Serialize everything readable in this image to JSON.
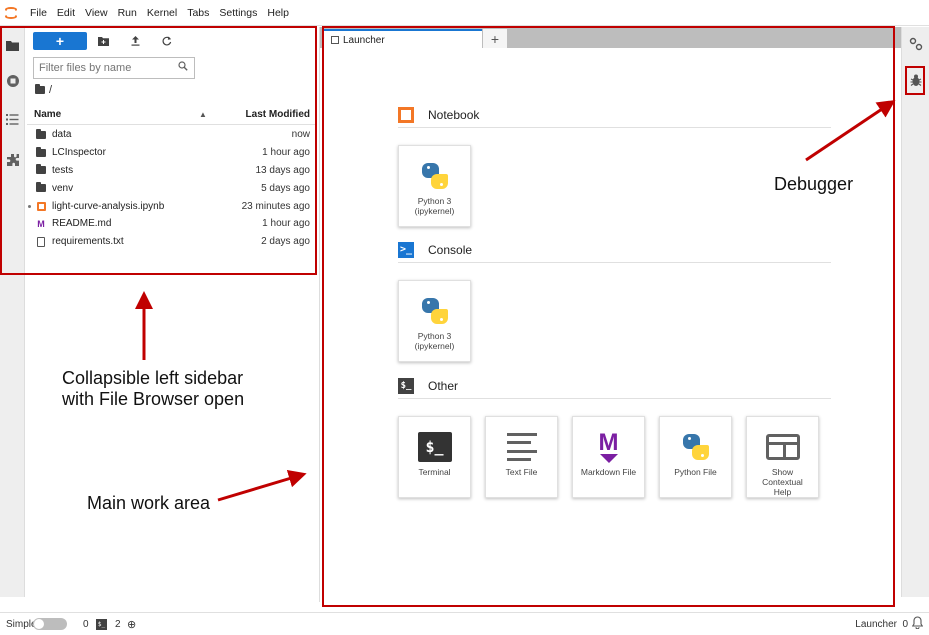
{
  "menu": [
    "File",
    "Edit",
    "View",
    "Run",
    "Kernel",
    "Tabs",
    "Settings",
    "Help"
  ],
  "filebrowser": {
    "new_label": "+",
    "filter_placeholder": "Filter files by name",
    "breadcrumb": "/",
    "header_name": "Name",
    "header_modified": "Last Modified",
    "sort_indicator": "▲",
    "files": [
      {
        "name": "data",
        "modified": "now",
        "type": "folder"
      },
      {
        "name": "LCInspector",
        "modified": "1 hour ago",
        "type": "folder"
      },
      {
        "name": "tests",
        "modified": "13 days ago",
        "type": "folder"
      },
      {
        "name": "venv",
        "modified": "5 days ago",
        "type": "folder"
      },
      {
        "name": "light-curve-analysis.ipynb",
        "modified": "23 minutes ago",
        "type": "notebook"
      },
      {
        "name": "README.md",
        "modified": "1 hour ago",
        "type": "markdown"
      },
      {
        "name": "requirements.txt",
        "modified": "2 days ago",
        "type": "text"
      }
    ]
  },
  "tabs": {
    "launcher_label": "Launcher",
    "add_label": "+"
  },
  "launcher": {
    "notebook_title": "Notebook",
    "console_title": "Console",
    "other_title": "Other",
    "console_glyph": ">_",
    "other_glyph": "$_",
    "notebook_kernel": "Python 3 (ipykernel)",
    "console_kernel": "Python 3 (ipykernel)",
    "other_items": [
      "Terminal",
      "Text File",
      "Markdown File",
      "Python File",
      "Show Contextual Help"
    ],
    "terminal_glyph": "$_",
    "markdown_glyph": "M"
  },
  "statusbar": {
    "simple_label": "Simple",
    "zero": "0",
    "term_glyph": "$_",
    "two": "2",
    "kernel_glyph": "⊕",
    "active": "Launcher",
    "notif_count": "0",
    "bell": "🔔"
  },
  "annotations": {
    "sidebar": "Collapsible left sidebar with File Browser open",
    "main": "Main work area",
    "debugger": "Debugger"
  },
  "colors": {
    "accent": "#1976d2",
    "annotation_red": "#c00000",
    "jupyter_orange": "#f37726",
    "markdown_purple": "#7b1fa2"
  }
}
